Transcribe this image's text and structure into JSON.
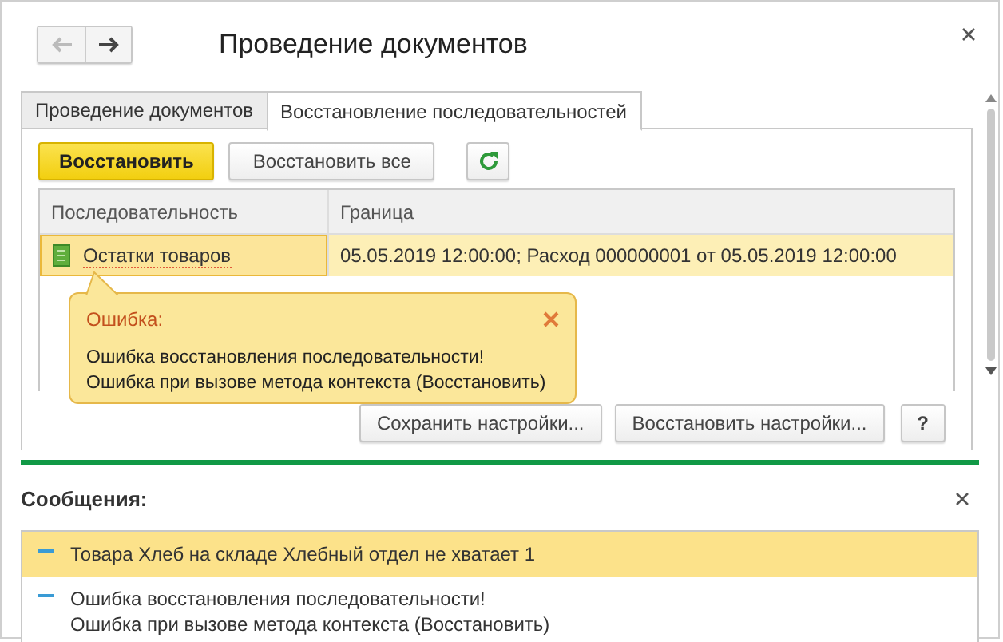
{
  "window": {
    "title": "Проведение документов"
  },
  "nav": [
    {
      "kind": "back",
      "disabled": true
    },
    {
      "kind": "forward",
      "disabled": false
    }
  ],
  "tabs": [
    {
      "label": "Проведение документов",
      "selected": false
    },
    {
      "label": "Восстановление последовательностей",
      "selected": true
    }
  ],
  "toolbar": [
    {
      "kind": "default",
      "label": "Восстановить"
    },
    {
      "kind": "plain",
      "label": "Восстановить все"
    },
    {
      "kind": "refresh"
    }
  ],
  "table": {
    "columns": [
      "Последовательность",
      "Граница"
    ],
    "rows": [
      {
        "cells": [
          "Остатки товаров",
          "05.05.2019 12:00:00; Расход 000000001 от 05.05.2019 12:00:00"
        ],
        "selected": true
      }
    ]
  },
  "tooltip": {
    "title": "Ошибка:",
    "lines": [
      "Ошибка восстановления последовательности!",
      "Ошибка при вызове метода контекста (Восстановить)"
    ]
  },
  "footer_buttons": [
    "Сохранить настройки...",
    "Восстановить настройки...",
    "?"
  ],
  "messages": {
    "title": "Сообщения:",
    "items": [
      {
        "lines": [
          "Товара Хлеб на складе Хлебный отдел не хватает 1"
        ],
        "selected": true
      },
      {
        "lines": [
          "Ошибка восстановления последовательности!",
          "Ошибка при вызове метода контекста (Восстановить)"
        ],
        "selected": false
      }
    ]
  }
}
